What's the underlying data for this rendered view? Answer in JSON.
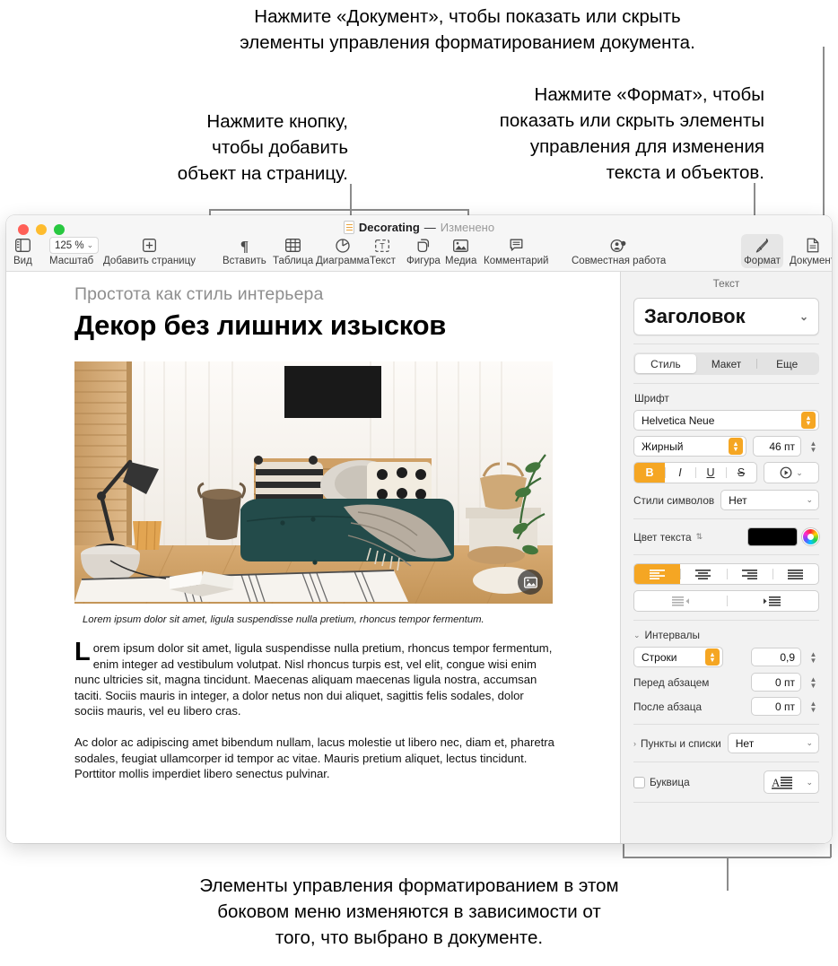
{
  "callouts": {
    "document": "Нажмите «Документ», чтобы показать или скрыть\nэлементы управления форматированием документа.",
    "format": "Нажмите «Формат», чтобы\nпоказать или скрыть элементы\nуправления для изменения\nтекста и объектов.",
    "insert": "Нажмите кнопку,\nчтобы добавить\nобъект на страницу.",
    "sidebar": "Элементы управления форматированием в этом\nбоковом меню изменяются в зависимости от\nтого, что выбрано в документе."
  },
  "window": {
    "title": {
      "name": "Decorating",
      "dash": "—",
      "status": "Изменено"
    },
    "toolbar": {
      "view": "Вид",
      "zoom_label": "Масштаб",
      "zoom_value": "125 %",
      "add_page": "Добавить страницу",
      "insert": "Вставить",
      "table": "Таблица",
      "chart": "Диаграмма",
      "text": "Текст",
      "shape": "Фигура",
      "media": "Медиа",
      "comment": "Комментарий",
      "collaborate": "Совместная работа",
      "format": "Формат",
      "document": "Документ"
    }
  },
  "document": {
    "eyebrow": "Простота как стиль интерьера",
    "headline": "Декор без лишних изысков",
    "caption": "Lorem ipsum dolor sit amet, ligula suspendisse nulla pretium, rhoncus tempor fermentum.",
    "paragraph1_dropcap": "L",
    "paragraph1": "orem ipsum dolor sit amet, ligula suspendisse nulla pretium, rhoncus tempor fermentum, enim integer ad vestibulum volutpat. Nisl rhoncus turpis est, vel elit, congue wisi enim nunc ultricies sit, magna tincidunt. Maecenas aliquam maecenas ligula nostra, accumsan taciti. Sociis mauris in integer, a dolor netus non dui aliquet, sagittis felis sodales, dolor sociis mauris, vel eu libero cras.",
    "paragraph2": "Ac dolor ac adipiscing amet bibendum nullam, lacus molestie ut libero nec, diam et, pharetra sodales, feugiat ullamcorper id tempor ac vitae. Mauris pretium aliquet, lectus tincidunt. Porttitor mollis imperdiet libero senectus pulvinar."
  },
  "inspector": {
    "title": "Текст",
    "paragraph_style": "Заголовок",
    "tabs": {
      "style": "Стиль",
      "layout": "Макет",
      "more": "Еще"
    },
    "font": {
      "section_label": "Шрифт",
      "family": "Helvetica Neue",
      "weight": "Жирный",
      "size": "46 пт",
      "bold": "B",
      "italic": "I",
      "underline": "U",
      "strikethrough": "S",
      "char_styles_label": "Стили символов",
      "char_styles_value": "Нет"
    },
    "color": {
      "label": "Цвет текста",
      "value": "#000000"
    },
    "spacing": {
      "section_label": "Интервалы",
      "mode": "Строки",
      "line_value": "0,9",
      "before_label": "Перед абзацем",
      "before_value": "0 пт",
      "after_label": "После абзаца",
      "after_value": "0 пт"
    },
    "bullets": {
      "label": "Пункты и списки",
      "value": "Нет"
    },
    "dropcap": {
      "label": "Буквица",
      "checked": false
    }
  },
  "colors": {
    "accent": "#f5a623",
    "toolbar_bg": "#f6f6f6",
    "inspector_bg": "#f2f2f2",
    "traffic_red": "#ff5f57",
    "traffic_yellow": "#febc2e",
    "traffic_green": "#28c840"
  }
}
